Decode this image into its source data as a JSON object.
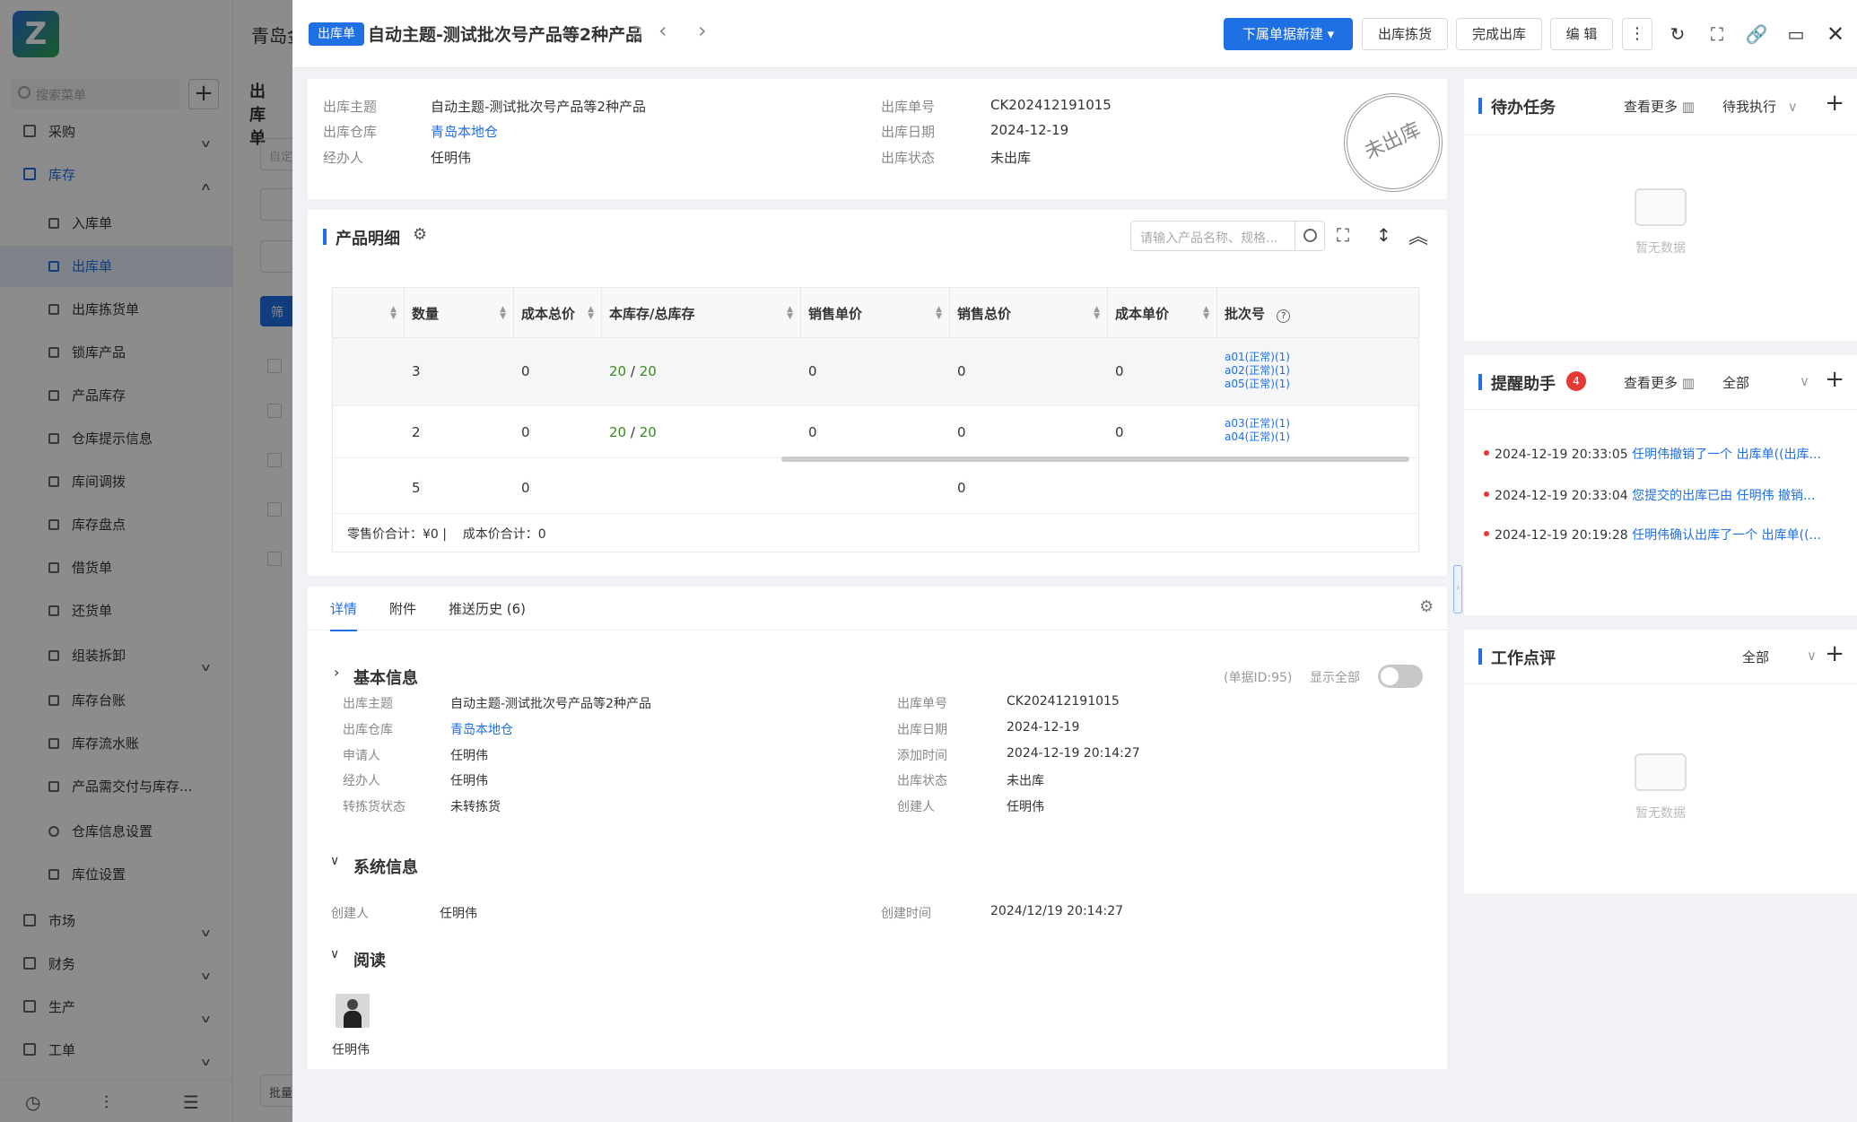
{
  "sidebar": {
    "search_placeholder": "搜索菜单",
    "menu": [
      {
        "label": "采购"
      },
      {
        "label": "库存"
      },
      {
        "label": "入库单"
      },
      {
        "label": "出库单"
      },
      {
        "label": "出库拣货单"
      },
      {
        "label": "锁库产品"
      },
      {
        "label": "产品库存"
      },
      {
        "label": "仓库提示信息"
      },
      {
        "label": "库间调拨"
      },
      {
        "label": "库存盘点"
      },
      {
        "label": "借货单"
      },
      {
        "label": "还货单"
      },
      {
        "label": "组装拆卸"
      },
      {
        "label": "库存台账"
      },
      {
        "label": "库存流水账"
      },
      {
        "label": "产品需交付与库存..."
      },
      {
        "label": "仓库信息设置"
      },
      {
        "label": "库位设置"
      },
      {
        "label": "市场"
      },
      {
        "label": "财务"
      },
      {
        "label": "生产"
      },
      {
        "label": "工单"
      }
    ]
  },
  "background": {
    "title": "青岛金",
    "tab": "出库单",
    "input_hint": "自定",
    "btn": "筛",
    "bottom_btn": "批量"
  },
  "drawer": {
    "tag": "出库单",
    "title": "自动主题-测试批次号产品等2种产品",
    "buttons": {
      "new_doc": "下属单据新建",
      "picking": "出库拣货",
      "complete": "完成出库",
      "edit": "编 辑"
    },
    "summary": {
      "subject_label": "出库主题",
      "subject": "自动主题-测试批次号产品等2种产品",
      "warehouse_label": "出库仓库",
      "warehouse": "青岛本地仓",
      "handler_label": "经办人",
      "handler": "任明伟",
      "no_label": "出库单号",
      "no": "CK202412191015",
      "date_label": "出库日期",
      "date": "2024-12-19",
      "status_label": "出库状态",
      "status": "未出库",
      "stamp": "未出库"
    },
    "products": {
      "title": "产品明细",
      "search_placeholder": "请输入产品名称、规格...",
      "columns": [
        "数量",
        "成本总价",
        "本库存/总库存",
        "销售单价",
        "销售总价",
        "成本单价",
        "批次号"
      ],
      "rows": [
        {
          "qty": "3",
          "cost_total": "0",
          "stock": "20",
          "stock_sep": "/",
          "stock_total": "20",
          "sale_price": "0",
          "sale_total": "0",
          "cost_price": "0",
          "batches": [
            "a01(正常)(1)",
            "a02(正常)(1)",
            "a05(正常)(1)"
          ]
        },
        {
          "qty": "2",
          "cost_total": "0",
          "stock": "20",
          "stock_sep": "/",
          "stock_total": "20",
          "sale_price": "0",
          "sale_total": "0",
          "cost_price": "0",
          "batches": [
            "a03(正常)(1)",
            "a04(正常)(1)"
          ]
        }
      ],
      "total_row": {
        "qty": "5",
        "cost_total": "0",
        "sale_total": "0"
      },
      "footer": "零售价合计：¥0 |    成本价合计：0"
    },
    "tabs": [
      "详情",
      "附件",
      "推送历史 (6)"
    ],
    "basic": {
      "title": "基本信息",
      "doc_id": "(单据ID:95)",
      "show_all": "显示全部",
      "left": [
        {
          "label": "出库主题",
          "value": "自动主题-测试批次号产品等2种产品"
        },
        {
          "label": "出库仓库",
          "value": "青岛本地仓"
        },
        {
          "label": "申请人",
          "value": "任明伟"
        },
        {
          "label": "经办人",
          "value": "任明伟"
        },
        {
          "label": "转拣货状态",
          "value": "未转拣货"
        }
      ],
      "right": [
        {
          "label": "出库单号",
          "value": "CK202412191015"
        },
        {
          "label": "出库日期",
          "value": "2024-12-19"
        },
        {
          "label": "添加时间",
          "value": "2024-12-19 20:14:27"
        },
        {
          "label": "出库状态",
          "value": "未出库"
        },
        {
          "label": "创建人",
          "value": "任明伟"
        }
      ]
    },
    "system": {
      "title": "系统信息",
      "creator_label": "创建人",
      "creator": "任明伟",
      "created_label": "创建时间",
      "created": "2024/12/19 20:14:27"
    },
    "read": {
      "title": "阅读",
      "user": "任明伟"
    }
  },
  "right": {
    "todo": {
      "title": "待办任务",
      "more": "查看更多",
      "filter": "待我执行",
      "empty": "暂无数据"
    },
    "remind": {
      "title": "提醒助手",
      "badge": "4",
      "more": "查看更多",
      "filter": "全部",
      "items": [
        {
          "time": "2024-12-19 20:33:05",
          "text": "任明伟撤销了一个 出库单((出库..."
        },
        {
          "time": "2024-12-19 20:33:04",
          "text": "您提交的出库已由 任明伟 撤销..."
        },
        {
          "time": "2024-12-19 20:19:28",
          "text": "任明伟确认出库了一个 出库单((..."
        }
      ]
    },
    "review": {
      "title": "工作点评",
      "filter": "全部",
      "empty": "暂无数据"
    }
  }
}
